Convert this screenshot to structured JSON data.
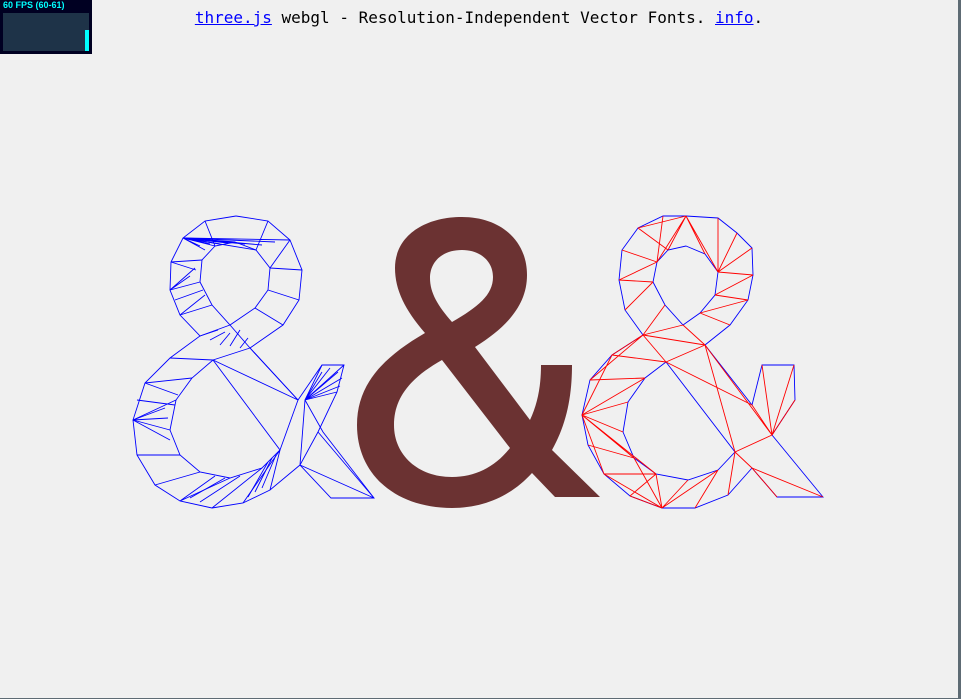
{
  "stats": {
    "fps_text": "60 FPS (60-61)",
    "bar_level": 0.55,
    "accent": "#00ffff",
    "background": "#000022"
  },
  "info": {
    "link_threejs": "three.js",
    "text_main": " webgl - Resolution-Independent Vector Fonts. ",
    "link_info": "info",
    "text_end": "."
  },
  "scene": {
    "glyph": "&",
    "left_wire_color": "#0000ff",
    "solid_color": "#6b3232",
    "right_outline_color": "#0000ff",
    "right_wire_color": "#ff0000"
  }
}
